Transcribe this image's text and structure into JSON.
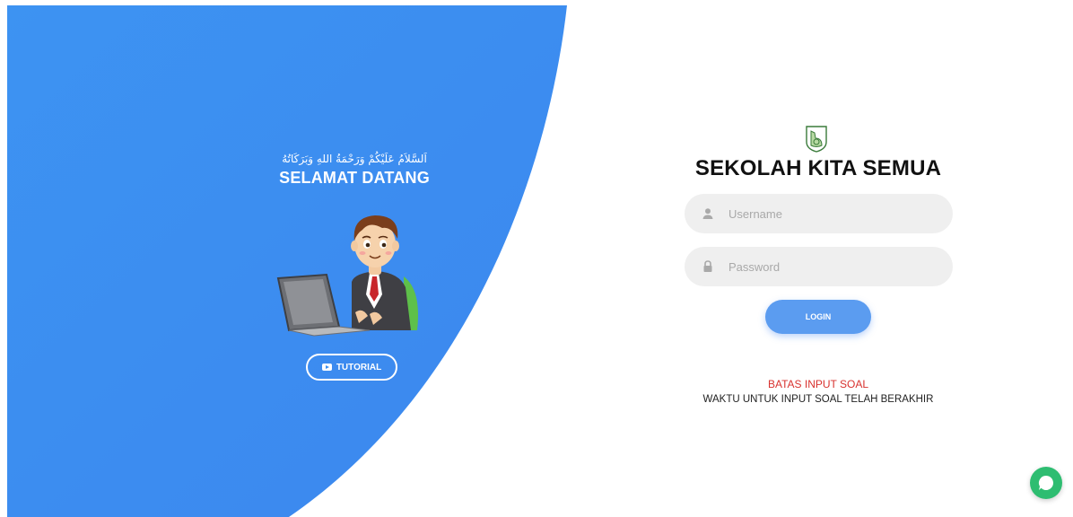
{
  "hero": {
    "greeting_arabic": "اَلسَّلاَمُ عَلَيْكُمْ وَرَحْمَةُ اللهِ وَبَرَكَاتُهُ",
    "welcome_title": "SELAMAT DATANG",
    "tutorial_label": "TUTORIAL"
  },
  "login": {
    "school_name": "SEKOLAH KITA SEMUA",
    "username_placeholder": "Username",
    "password_placeholder": "Password",
    "login_label": "LOGIN"
  },
  "notice": {
    "title": "BATAS INPUT SOAL",
    "message": "WAKTU UNTUK INPUT SOAL TELAH BERAKHIR"
  },
  "colors": {
    "primary_blue": "#3b8ff0",
    "button_blue": "#5b9cf0",
    "notice_red": "#d8322f",
    "chat_green": "#2ebd71"
  }
}
